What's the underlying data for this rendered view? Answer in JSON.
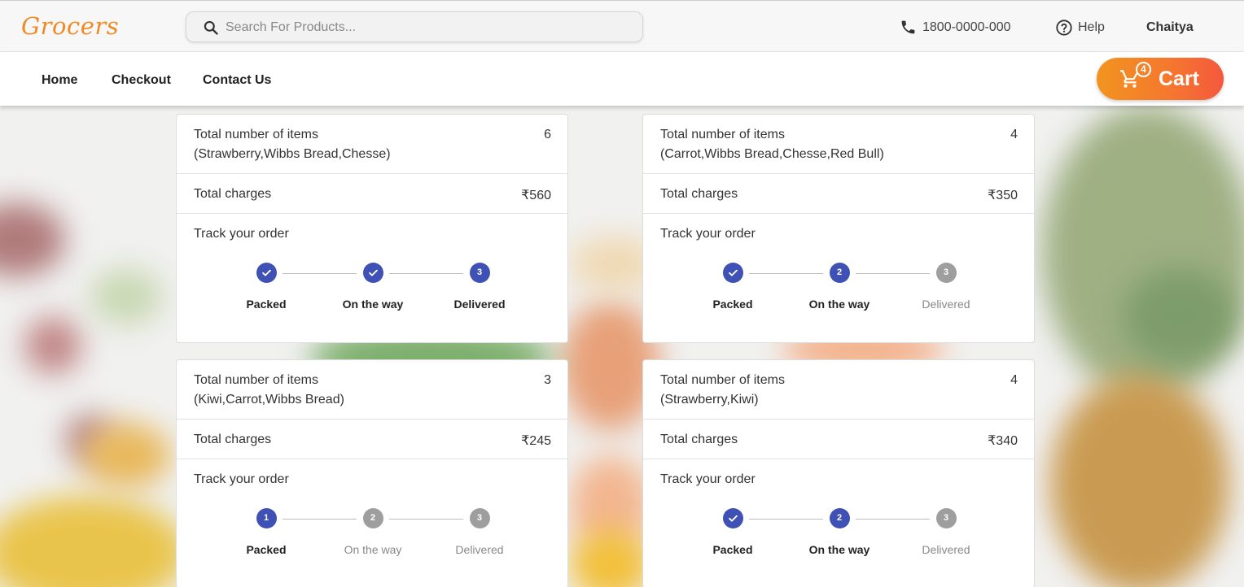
{
  "header": {
    "logo": "Grocers",
    "search_placeholder": "Search For Products...",
    "phone": "1800-0000-000",
    "help": "Help",
    "user": "Chaitya"
  },
  "nav": {
    "links": [
      "Home",
      "Checkout",
      "Contact Us"
    ],
    "cart_label": "Cart",
    "cart_count": "4"
  },
  "labels": {
    "items": "Total number of items",
    "charges": "Total charges",
    "track": "Track your order",
    "steps": [
      "Packed",
      "On the way",
      "Delivered"
    ]
  },
  "orders": [
    {
      "count": "6",
      "products": "(Strawberry,Wibbs Bread,Chesse)",
      "charges": "₹560",
      "step_marks": [
        "✓",
        "✓",
        "3"
      ],
      "step_states": [
        "done",
        "done",
        "active"
      ]
    },
    {
      "count": "4",
      "products": "(Carrot,Wibbs Bread,Chesse,Red Bull)",
      "charges": "₹350",
      "step_marks": [
        "✓",
        "2",
        "3"
      ],
      "step_states": [
        "done",
        "active",
        "todo"
      ]
    },
    {
      "count": "3",
      "products": "(Kiwi,Carrot,Wibbs Bread)",
      "charges": "₹245",
      "step_marks": [
        "1",
        "2",
        "3"
      ],
      "step_states": [
        "active",
        "todo",
        "todo"
      ]
    },
    {
      "count": "4",
      "products": "(Strawberry,Kiwi)",
      "charges": "₹340",
      "step_marks": [
        "✓",
        "2",
        "3"
      ],
      "step_states": [
        "done",
        "active",
        "todo"
      ]
    }
  ],
  "colors": {
    "accent": "#3f51b5",
    "pending": "#9e9e9e",
    "cart_gradient_start": "#f2941f",
    "cart_gradient_end": "#f4583d",
    "logo": "#f08a24"
  }
}
